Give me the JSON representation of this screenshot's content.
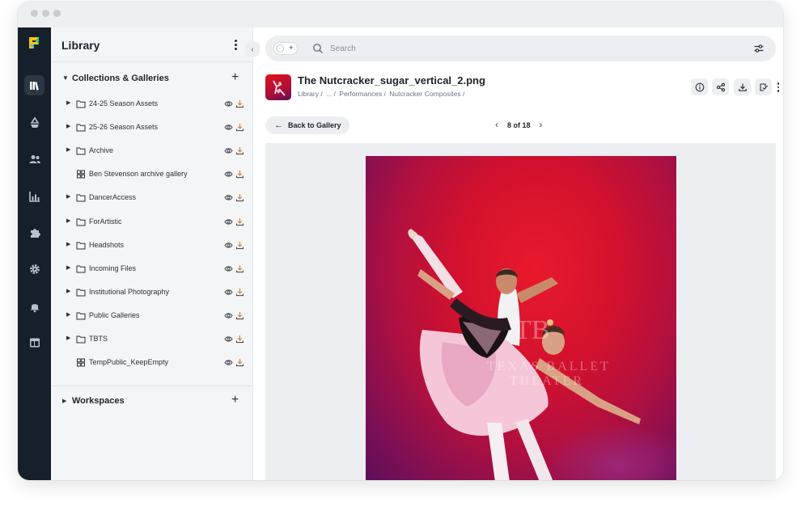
{
  "sidebar": {
    "title": "Library",
    "collapse_icon": "chevron-left-icon",
    "collections": {
      "label": "Collections & Galleries",
      "items": [
        {
          "label": "24-25 Season Assets",
          "type": "folder"
        },
        {
          "label": "25-26 Season Assets",
          "type": "folder"
        },
        {
          "label": "Archive",
          "type": "folder"
        },
        {
          "label": "Ben Stevenson archive gallery",
          "type": "gallery"
        },
        {
          "label": "DancerAccess",
          "type": "folder"
        },
        {
          "label": "ForArtistic",
          "type": "folder"
        },
        {
          "label": "Headshots",
          "type": "folder"
        },
        {
          "label": "Incoming Files",
          "type": "folder"
        },
        {
          "label": "Institutional Photography",
          "type": "folder"
        },
        {
          "label": "Public Galleries",
          "type": "folder"
        },
        {
          "label": "TBTS",
          "type": "folder"
        },
        {
          "label": "TempPublic_KeepEmpty",
          "type": "gallery"
        }
      ]
    },
    "workspaces": {
      "label": "Workspaces"
    }
  },
  "rail": {
    "icons": [
      "logo-icon",
      "library-icon",
      "recycle-icon",
      "users-icon",
      "chart-icon",
      "puzzle-icon",
      "settings-icon",
      "bell-icon",
      "layout-icon"
    ],
    "active": "library-icon"
  },
  "search": {
    "placeholder": "Search"
  },
  "asset": {
    "title": "The Nutcracker_sugar_vertical_2.png",
    "breadcrumb": [
      "Library /",
      "... /",
      "Performances /",
      "Nutcracker Composites /"
    ],
    "actions": [
      "info-icon",
      "share-icon",
      "download-icon",
      "approve-icon"
    ]
  },
  "nav": {
    "back_label": "Back to Gallery",
    "pager_label": "8 of 18"
  },
  "photo": {
    "watermark_line1": "TEXAS BALLET",
    "watermark_line2": "THEATER",
    "watermark_logo": "TB"
  },
  "colors": {
    "rail_bg": "#16202a",
    "accent_logo": "#f5c518",
    "photo_red": "#d2112e",
    "photo_purple": "#5c0f5a"
  }
}
